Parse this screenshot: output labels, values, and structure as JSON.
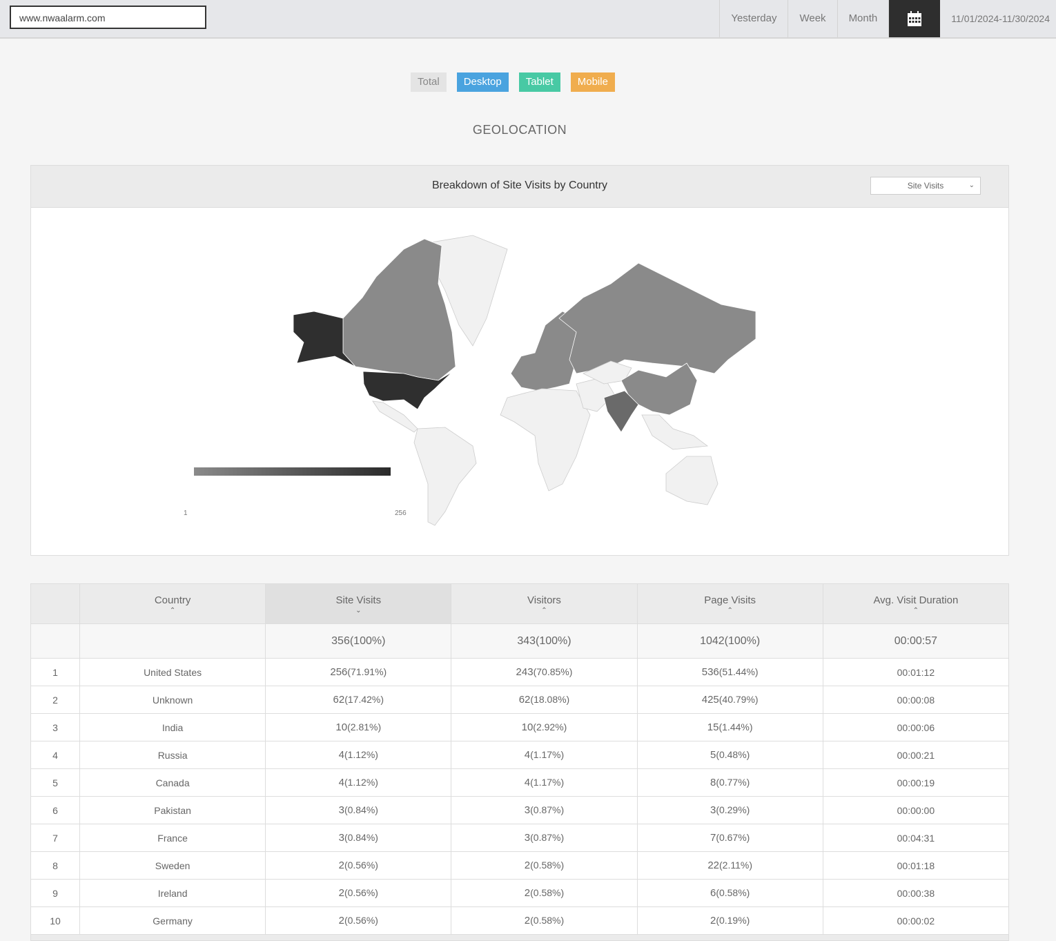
{
  "site": "www.nwaalarm.com",
  "ranges": [
    "Yesterday",
    "Week",
    "Month"
  ],
  "date_range": "11/01/2024-11/30/2024",
  "filters": [
    {
      "label": "Total",
      "color": "#e4e4e4"
    },
    {
      "label": "Desktop",
      "color": "#4aa3df"
    },
    {
      "label": "Tablet",
      "color": "#48c9a4"
    },
    {
      "label": "Mobile",
      "color": "#f0ad4e"
    }
  ],
  "section_title": "GEOLOCATION",
  "panel": {
    "title": "Breakdown of Site Visits by Country",
    "metric_select": "Site Visits",
    "legend_min": "1",
    "legend_max": "256"
  },
  "table": {
    "headers": [
      "Country",
      "Site Visits",
      "Visitors",
      "Page Visits",
      "Avg. Visit Duration"
    ],
    "totals": [
      "356(100%)",
      "343(100%)",
      "1042(100%)",
      "00:00:57"
    ],
    "rows": [
      [
        "1",
        "United States",
        "256",
        "(71.91%)",
        "243",
        "(70.85%)",
        "536",
        "(51.44%)",
        "00:01:12"
      ],
      [
        "2",
        "Unknown",
        "62",
        "(17.42%)",
        "62",
        "(18.08%)",
        "425",
        "(40.79%)",
        "00:00:08"
      ],
      [
        "3",
        "India",
        "10",
        "(2.81%)",
        "10",
        "(2.92%)",
        "15",
        "(1.44%)",
        "00:00:06"
      ],
      [
        "4",
        "Russia",
        "4",
        "(1.12%)",
        "4",
        "(1.17%)",
        "5",
        "(0.48%)",
        "00:00:21"
      ],
      [
        "5",
        "Canada",
        "4",
        "(1.12%)",
        "4",
        "(1.17%)",
        "8",
        "(0.77%)",
        "00:00:19"
      ],
      [
        "6",
        "Pakistan",
        "3",
        "(0.84%)",
        "3",
        "(0.87%)",
        "3",
        "(0.29%)",
        "00:00:00"
      ],
      [
        "7",
        "France",
        "3",
        "(0.84%)",
        "3",
        "(0.87%)",
        "7",
        "(0.67%)",
        "00:04:31"
      ],
      [
        "8",
        "Sweden",
        "2",
        "(0.56%)",
        "2",
        "(0.58%)",
        "22",
        "(2.11%)",
        "00:01:18"
      ],
      [
        "9",
        "Ireland",
        "2",
        "(0.56%)",
        "2",
        "(0.58%)",
        "6",
        "(0.58%)",
        "00:00:38"
      ],
      [
        "10",
        "Germany",
        "2",
        "(0.56%)",
        "2",
        "(0.58%)",
        "2",
        "(0.19%)",
        "00:00:02"
      ]
    ]
  }
}
